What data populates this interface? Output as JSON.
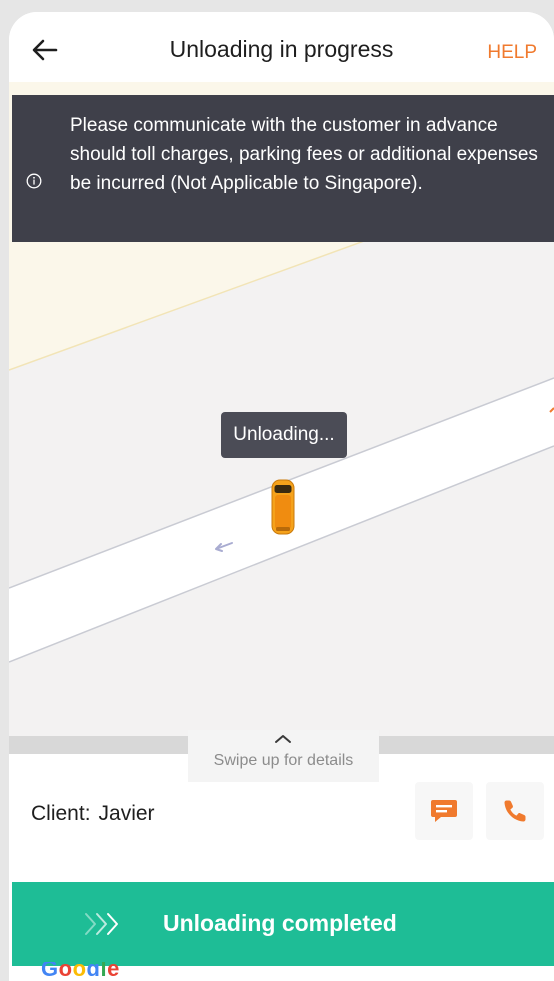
{
  "header": {
    "title": "Unloading in progress",
    "help_label": "HELP"
  },
  "notice": {
    "text": "Please communicate with the customer in advance should toll charges, parking fees or additional expenses be incurred (Not Applicable to Singapore)."
  },
  "map": {
    "status_label": "Unloading..."
  },
  "sheet": {
    "swipe_label": "Swipe up for details"
  },
  "client": {
    "label": "Client:",
    "name": "Javier"
  },
  "actions": {
    "complete_label": "Unloading completed"
  },
  "footer": {
    "google_logo": "Google"
  },
  "icons": {
    "back": "arrow-left-icon",
    "info": "info-icon",
    "chat": "chat-icon",
    "phone": "phone-icon",
    "swipe": "chevron-up-icon",
    "complete": "triple-chevron-right-icon"
  },
  "colors": {
    "accent_orange": "#f07a2e",
    "complete_green": "#1ebd96",
    "banner_dark": "#3f404a",
    "van_orange": "#f5a21b"
  }
}
